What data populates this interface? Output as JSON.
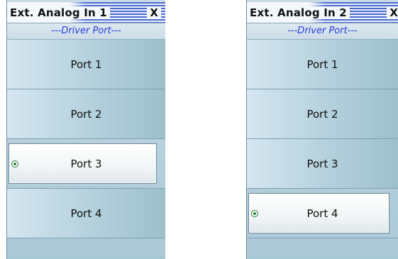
{
  "panels": [
    {
      "title": "Ext. Analog In 1",
      "close": "X",
      "section": "---Driver Port---",
      "ports": [
        "Port 1",
        "Port 2",
        "Port 3",
        "Port 4"
      ],
      "selected": "Port 3"
    },
    {
      "title": "Ext. Analog In 2",
      "close": "X",
      "section": "---Driver Port---",
      "ports": [
        "Port 1",
        "Port 2",
        "Port 3",
        "Port 4"
      ],
      "selected": "Port 4"
    }
  ],
  "colors": {
    "section_text": "#2a3ad6",
    "radio": "#2e8a3c"
  }
}
